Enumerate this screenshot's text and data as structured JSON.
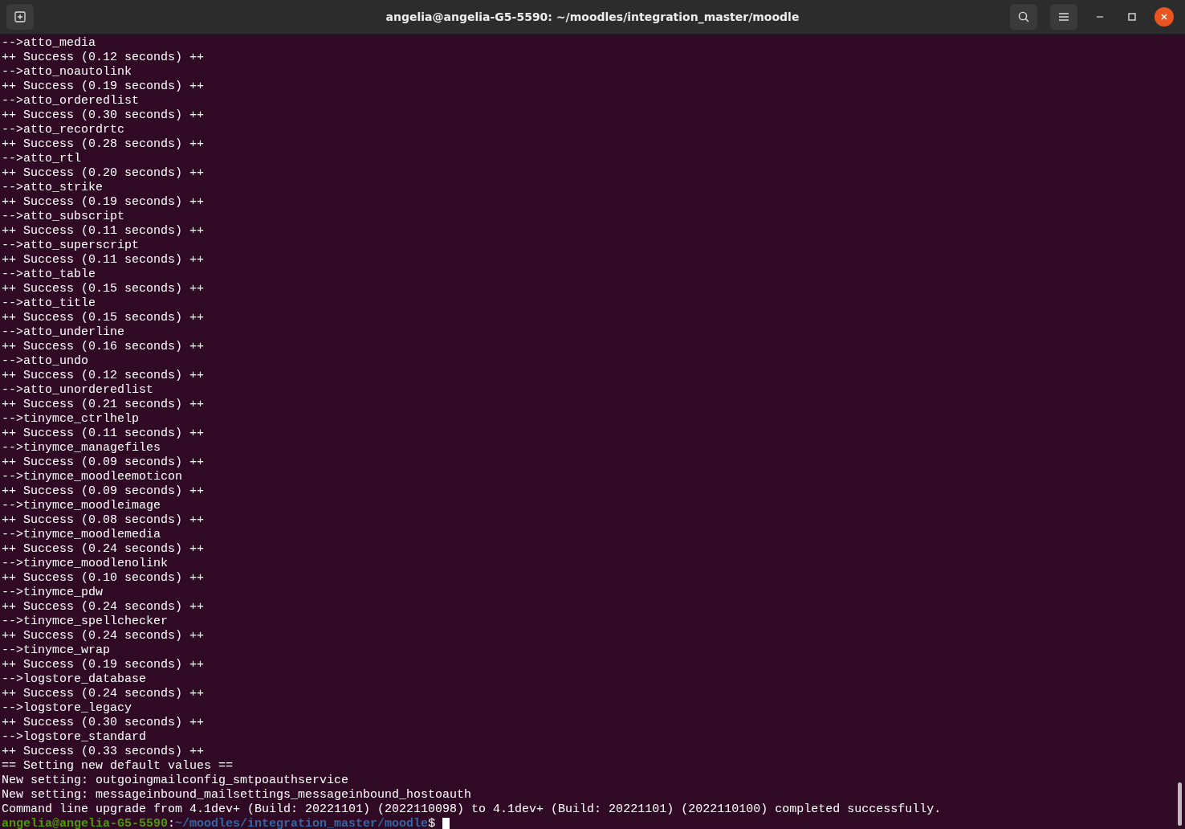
{
  "window": {
    "title": "angelia@angelia-G5-5590: ~/moodles/integration_master/moodle"
  },
  "output": [
    {
      "text": "-->atto_media"
    },
    {
      "text": "++ Success (0.12 seconds) ++"
    },
    {
      "text": "-->atto_noautolink"
    },
    {
      "text": "++ Success (0.19 seconds) ++"
    },
    {
      "text": "-->atto_orderedlist"
    },
    {
      "text": "++ Success (0.30 seconds) ++"
    },
    {
      "text": "-->atto_recordrtc"
    },
    {
      "text": "++ Success (0.28 seconds) ++"
    },
    {
      "text": "-->atto_rtl"
    },
    {
      "text": "++ Success (0.20 seconds) ++"
    },
    {
      "text": "-->atto_strike"
    },
    {
      "text": "++ Success (0.19 seconds) ++"
    },
    {
      "text": "-->atto_subscript"
    },
    {
      "text": "++ Success (0.11 seconds) ++"
    },
    {
      "text": "-->atto_superscript"
    },
    {
      "text": "++ Success (0.11 seconds) ++"
    },
    {
      "text": "-->atto_table"
    },
    {
      "text": "++ Success (0.15 seconds) ++"
    },
    {
      "text": "-->atto_title"
    },
    {
      "text": "++ Success (0.15 seconds) ++"
    },
    {
      "text": "-->atto_underline"
    },
    {
      "text": "++ Success (0.16 seconds) ++"
    },
    {
      "text": "-->atto_undo"
    },
    {
      "text": "++ Success (0.12 seconds) ++"
    },
    {
      "text": "-->atto_unorderedlist"
    },
    {
      "text": "++ Success (0.21 seconds) ++"
    },
    {
      "text": "-->tinymce_ctrlhelp"
    },
    {
      "text": "++ Success (0.11 seconds) ++"
    },
    {
      "text": "-->tinymce_managefiles"
    },
    {
      "text": "++ Success (0.09 seconds) ++"
    },
    {
      "text": "-->tinymce_moodleemoticon"
    },
    {
      "text": "++ Success (0.09 seconds) ++"
    },
    {
      "text": "-->tinymce_moodleimage"
    },
    {
      "text": "++ Success (0.08 seconds) ++"
    },
    {
      "text": "-->tinymce_moodlemedia"
    },
    {
      "text": "++ Success (0.24 seconds) ++"
    },
    {
      "text": "-->tinymce_moodlenolink"
    },
    {
      "text": "++ Success (0.10 seconds) ++"
    },
    {
      "text": "-->tinymce_pdw"
    },
    {
      "text": "++ Success (0.24 seconds) ++"
    },
    {
      "text": "-->tinymce_spellchecker"
    },
    {
      "text": "++ Success (0.24 seconds) ++"
    },
    {
      "text": "-->tinymce_wrap"
    },
    {
      "text": "++ Success (0.19 seconds) ++"
    },
    {
      "text": "-->logstore_database"
    },
    {
      "text": "++ Success (0.24 seconds) ++"
    },
    {
      "text": "-->logstore_legacy"
    },
    {
      "text": "++ Success (0.30 seconds) ++"
    },
    {
      "text": "-->logstore_standard"
    },
    {
      "text": "++ Success (0.33 seconds) ++"
    },
    {
      "text": "== Setting new default values =="
    },
    {
      "text": "New setting: outgoingmailconfig_smtpoauthservice"
    },
    {
      "text": "New setting: messageinbound_mailsettings_messageinbound_hostoauth"
    },
    {
      "text": "Command line upgrade from 4.1dev+ (Build: 20221101) (2022110098) to 4.1dev+ (Build: 20221101) (2022110100) completed successfully."
    }
  ],
  "prompt": {
    "user_host": "angelia@angelia-G5-5590",
    "separator": ":",
    "path": "~/moodles/integration_master/moodle",
    "symbol": "$"
  }
}
